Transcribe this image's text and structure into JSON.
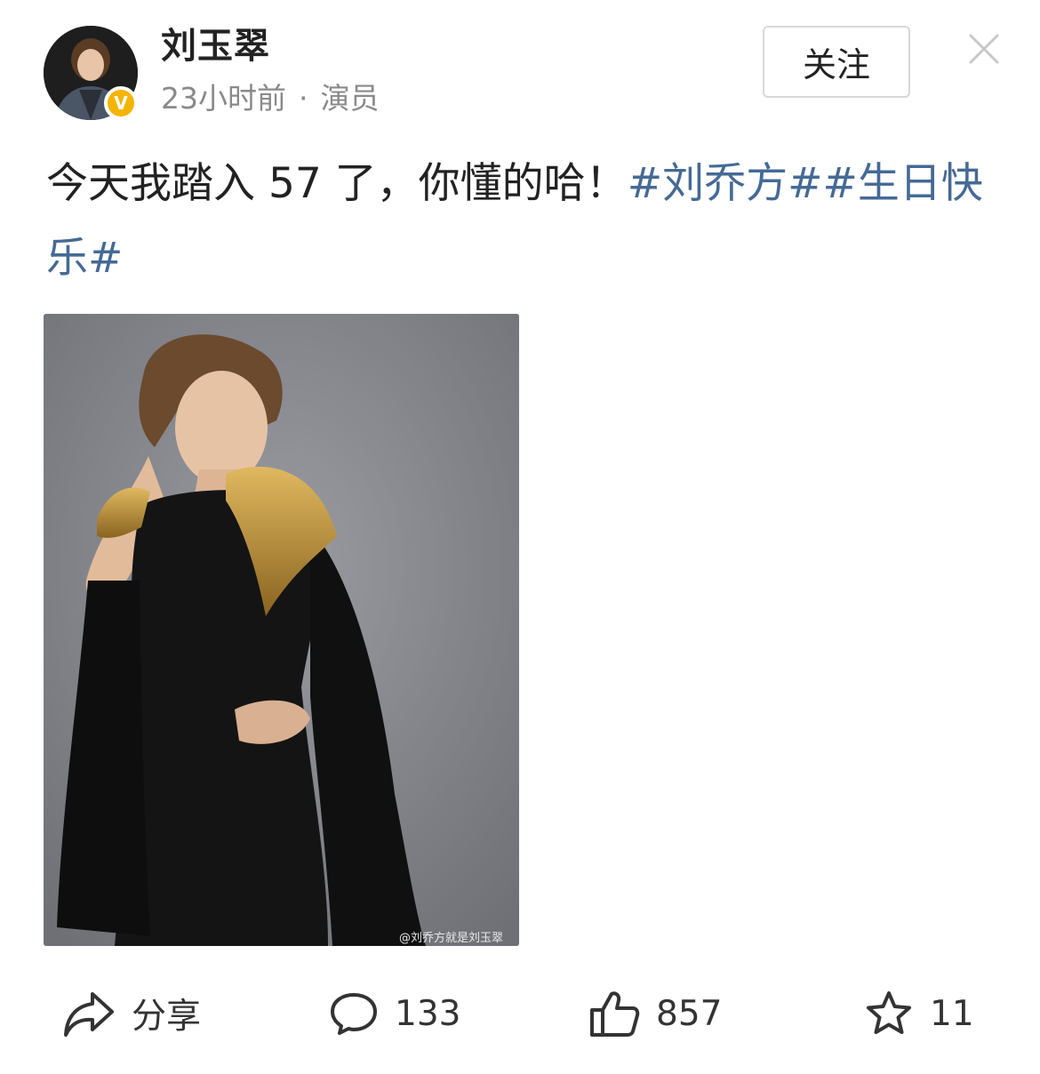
{
  "post": {
    "author": "刘玉翠",
    "time": "23小时前",
    "separator": "·",
    "role": "演员",
    "verified_badge": "V",
    "follow_label": "关注",
    "text_plain": "今天我踏入 57 了，你懂的哈！",
    "hashtag_1": "#刘乔方#",
    "hashtag_2": "#生日快乐#",
    "image_watermark": "@刘乔方就是刘玉翠"
  },
  "actions": {
    "share_label": "分享",
    "comments": "133",
    "likes": "857",
    "favorites": "11"
  },
  "colors": {
    "hashtag": "#456a95",
    "badge": "#f4b400",
    "meta_text": "#8a8a8a"
  }
}
